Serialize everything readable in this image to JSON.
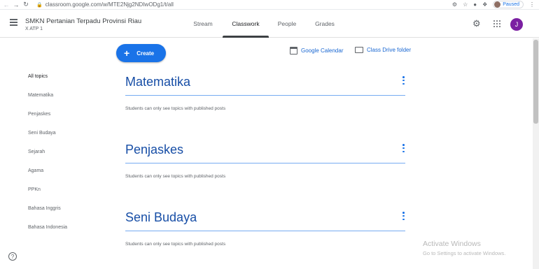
{
  "browser": {
    "url": "classroom.google.com/w/MTE2Njg2NDIwODg1/t/all",
    "profile_status": "Paused"
  },
  "header": {
    "class_name": "SMKN Pertanian Terpadu Provinsi Riau",
    "section": "X ATP 1",
    "tabs": [
      {
        "label": "Stream"
      },
      {
        "label": "Classwork"
      },
      {
        "label": "People"
      },
      {
        "label": "Grades"
      }
    ],
    "active_tab": "Classwork",
    "avatar_letter": "J",
    "avatar_color": "#7b1fa2"
  },
  "toolbar": {
    "create_label": "Create",
    "calendar_label": "Google Calendar",
    "drive_label": "Class Drive folder",
    "accent_color": "#1a73e8"
  },
  "sidebar": {
    "items": [
      {
        "label": "All topics"
      },
      {
        "label": "Matematika"
      },
      {
        "label": "Penjaskes"
      },
      {
        "label": "Seni Budaya"
      },
      {
        "label": "Sejarah"
      },
      {
        "label": "Agama"
      },
      {
        "label": "PPKn"
      },
      {
        "label": "Bahasa Inggris"
      },
      {
        "label": "Bahasa Indonesia"
      }
    ]
  },
  "topics": [
    {
      "title": "Matematika",
      "note": "Students can only see topics with published posts"
    },
    {
      "title": "Penjaskes",
      "note": "Students can only see topics with published posts"
    },
    {
      "title": "Seni Budaya",
      "note": "Students can only see topics with published posts"
    }
  ],
  "watermark": {
    "title": "Activate Windows",
    "subtitle": "Go to Settings to activate Windows."
  }
}
